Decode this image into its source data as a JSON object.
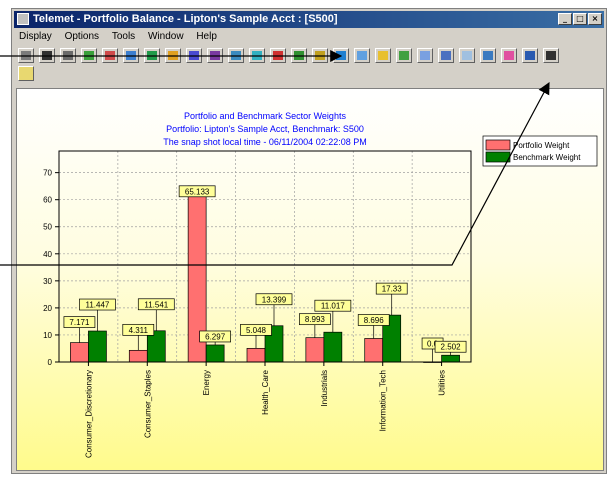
{
  "window": {
    "title": "Telemet - Portfolio Balance - Lipton's Sample Acct : [S500]"
  },
  "menu": [
    "Display",
    "Options",
    "Tools",
    "Window",
    "Help"
  ],
  "window_buttons": {
    "minimize": "_",
    "maximize": "□",
    "close": "×"
  },
  "toolbar": {
    "row1_count": 26,
    "colors": [
      "#7b7b7b",
      "#2f2f2f",
      "#6a6a6a",
      "#3aa03a",
      "#d04a4a",
      "#3c7fd0",
      "#1f9a4a",
      "#e0a020",
      "#4a4ad0",
      "#7a3aa0",
      "#3a8ac0",
      "#30b0c0",
      "#d03030",
      "#309030",
      "#c0a020",
      "#2080d0",
      "#60a0e0",
      "#e8c030",
      "#40a040",
      "#7aa0e0",
      "#4a70c0",
      "#a0c0e0",
      "#3a7ac0",
      "#e050a0",
      "#2a5ab0",
      "#303030"
    ],
    "row2": [
      "help-icon"
    ]
  },
  "chart_data": {
    "type": "bar",
    "title_lines": [
      "Portfolio and Benchmark Sector Weights",
      "Portfolio: Lipton's Sample Acct, Benchmark: S500",
      "The snap shot local time - 06/11/2004 02:22:08 PM"
    ],
    "categories": [
      "Consumer_Discretionary",
      "Consumer_Staples",
      "Energy",
      "Health_Care",
      "Industrials",
      "Information_Tech",
      "Utilities"
    ],
    "series": [
      {
        "name": "Portfolio Weight",
        "color": "#ff7070",
        "values": [
          7.171,
          4.311,
          65.133,
          5.048,
          8.993,
          8.696,
          0.0
        ]
      },
      {
        "name": "Benchmark Weight",
        "color": "#008000",
        "values": [
          11.447,
          11.541,
          6.297,
          13.399,
          11.017,
          17.33,
          2.502
        ]
      }
    ],
    "data_labels": [
      [
        "7.171",
        "4.311",
        "65.133",
        "5.048",
        "8.993",
        "8.696",
        "0.0"
      ],
      [
        "11.447",
        "11.541",
        "6.297",
        "13.399",
        "11.017",
        "17.33",
        "2.502"
      ]
    ],
    "yticks": [
      0,
      10,
      20,
      30,
      40,
      50,
      60,
      70
    ],
    "ylim": [
      0,
      78
    ],
    "grid": true,
    "legend_position": "right"
  }
}
